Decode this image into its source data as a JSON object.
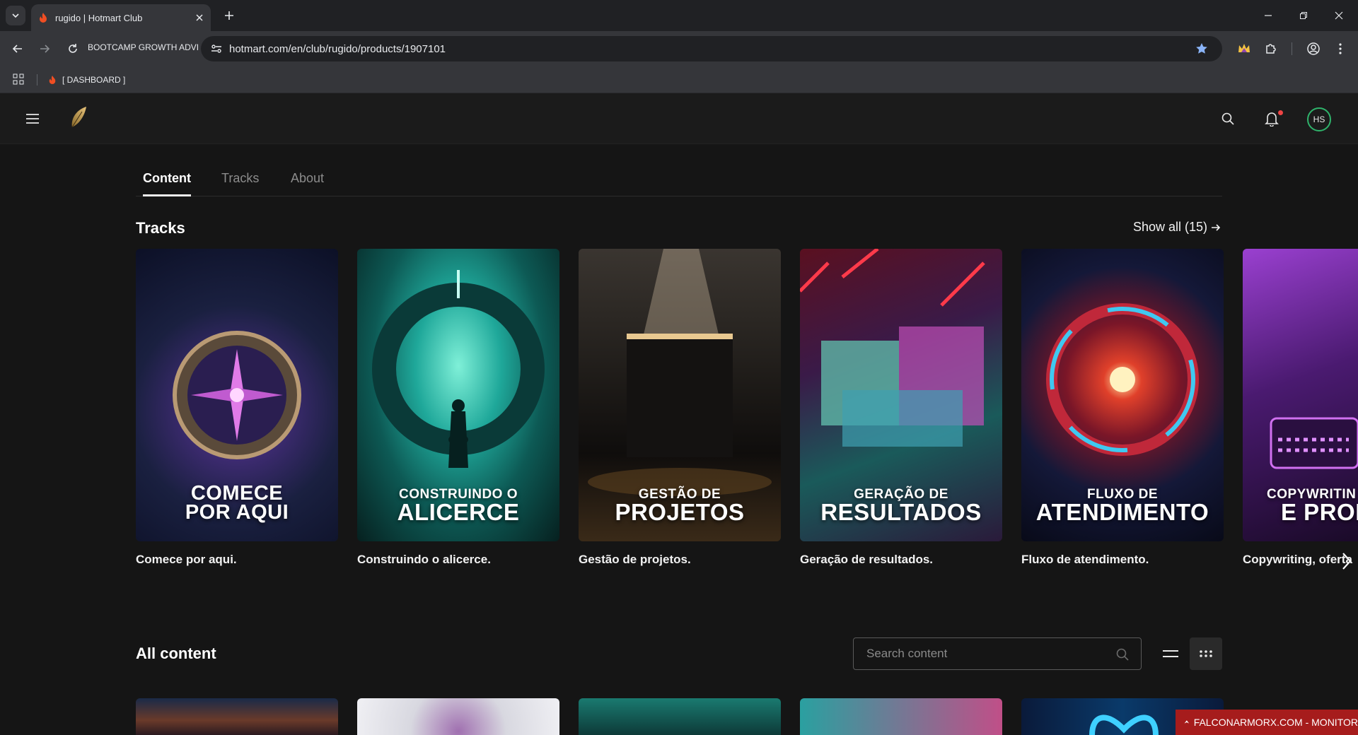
{
  "browser": {
    "tab_title": "rugido | Hotmart Club",
    "page_chip": "BOOTCAMP GROWTH ADVI",
    "url": "hotmart.com/en/club/rugido/products/1907101",
    "bookmark_label": "[ DASHBOARD ]"
  },
  "subtabs": [
    "Content",
    "Tracks",
    "About"
  ],
  "tracks_section": {
    "title": "Tracks",
    "show_all": "Show all (15)",
    "items": [
      {
        "overlay_top": "COMECE",
        "overlay_bottom": "POR AQUI",
        "label": "Comece por aqui."
      },
      {
        "overlay_top": "CONSTRUINDO O",
        "overlay_bottom": "ALICERCE",
        "label": "Construindo o alicerce."
      },
      {
        "overlay_top": "GESTÃO DE",
        "overlay_bottom": "PROJETOS",
        "label": "Gestão de projetos."
      },
      {
        "overlay_top": "GERAÇÃO DE",
        "overlay_bottom": "RESULTADOS",
        "label": "Geração de resultados."
      },
      {
        "overlay_top": "FLUXO DE",
        "overlay_bottom": "ATENDIMENTO",
        "label": "Fluxo de atendimento."
      },
      {
        "overlay_top": "COPYWRITIN",
        "overlay_bottom": "E PROD",
        "label": "Copywriting, oferta"
      }
    ]
  },
  "all_content": {
    "title": "All content",
    "search_placeholder": "Search content"
  },
  "header": {
    "avatar_initials": "HS"
  },
  "watermark": "FALCONARMORX.COM - MONITOR",
  "colors": {
    "background": "#151515",
    "header": "#1b1b1b",
    "avatar_ring": "#2fb36b",
    "notification": "#ef4444"
  }
}
